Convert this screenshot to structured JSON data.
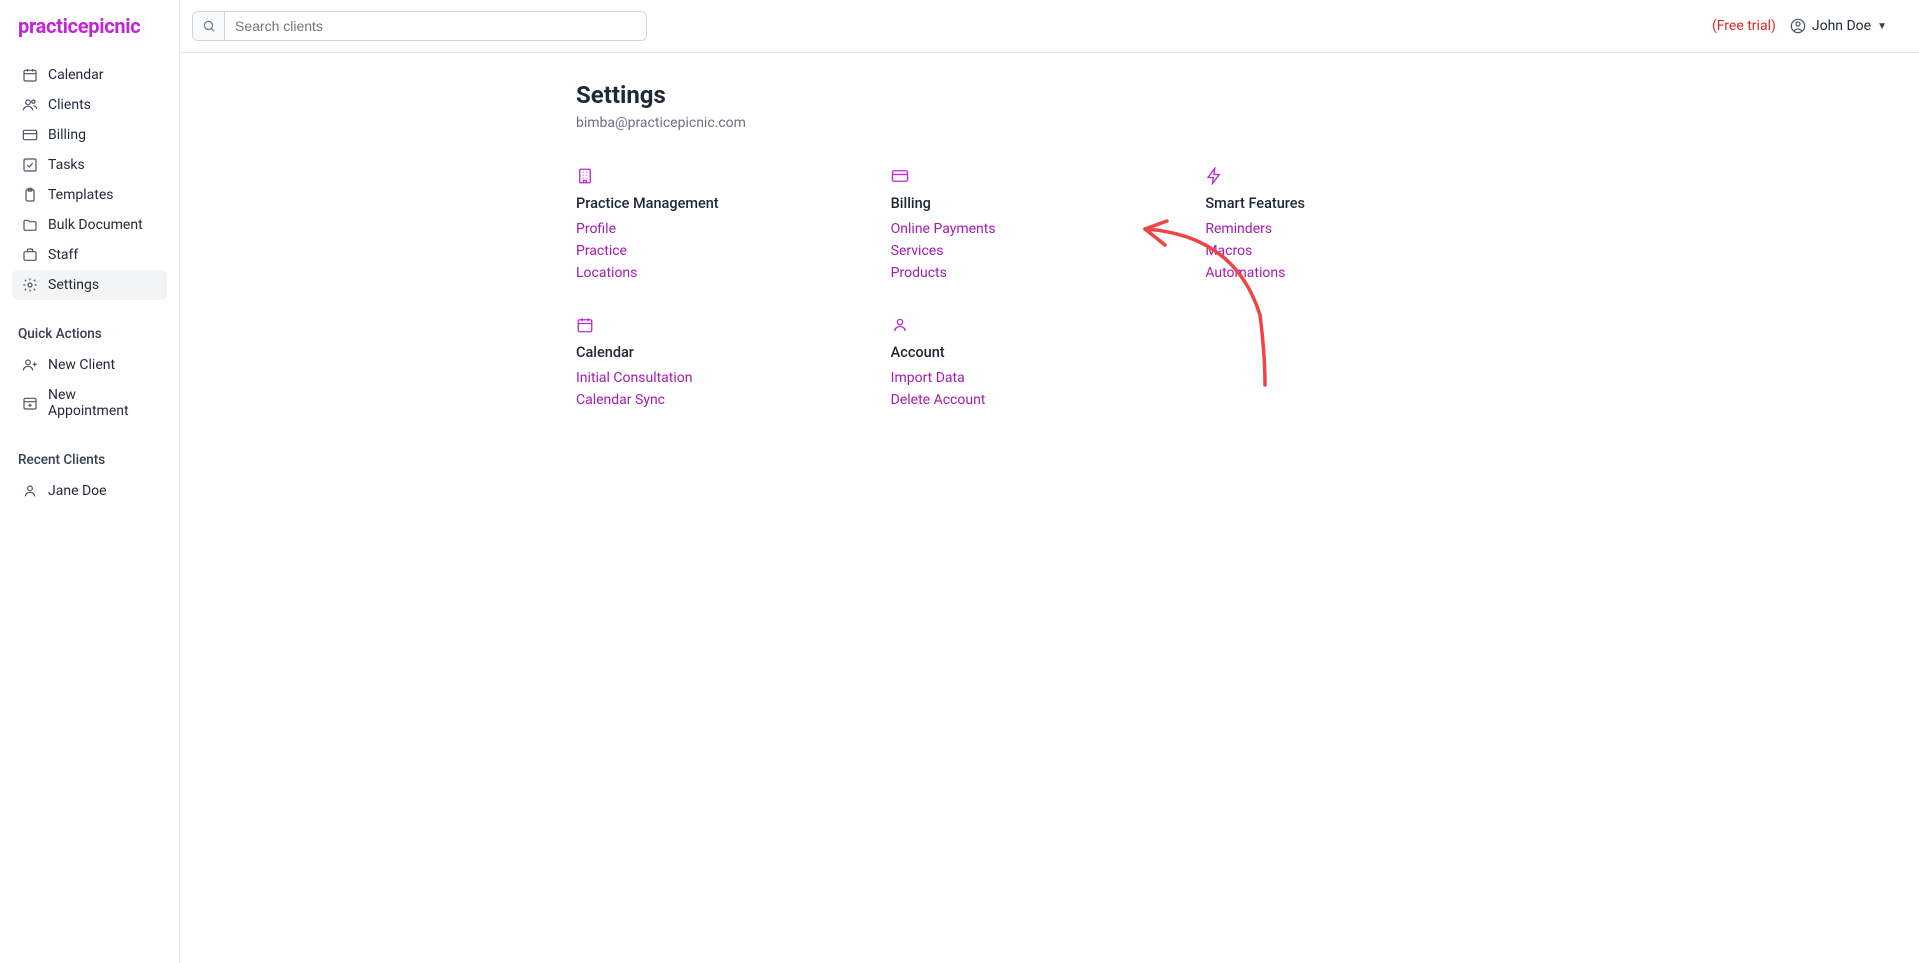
{
  "brand": "practicepicnic",
  "search": {
    "placeholder": "Search clients"
  },
  "topbar": {
    "trial": "(Free trial)",
    "user": "John Doe"
  },
  "nav": {
    "items": [
      {
        "label": "Calendar",
        "icon": "calendar"
      },
      {
        "label": "Clients",
        "icon": "users"
      },
      {
        "label": "Billing",
        "icon": "card"
      },
      {
        "label": "Tasks",
        "icon": "check-square"
      },
      {
        "label": "Templates",
        "icon": "clipboard"
      },
      {
        "label": "Bulk Document",
        "icon": "folder"
      },
      {
        "label": "Staff",
        "icon": "briefcase"
      },
      {
        "label": "Settings",
        "icon": "gear",
        "active": true
      }
    ],
    "quick_label": "Quick Actions",
    "quick": [
      {
        "label": "New Client",
        "icon": "user-plus"
      },
      {
        "label": "New Appointment",
        "icon": "calendar-plus"
      }
    ],
    "recent_label": "Recent Clients",
    "recent": [
      {
        "label": "Jane Doe",
        "icon": "user"
      }
    ]
  },
  "page": {
    "title": "Settings",
    "email": "bimba@practicepicnic.com",
    "cards": [
      {
        "title": "Practice Management",
        "icon": "building",
        "links": [
          "Profile",
          "Practice",
          "Locations"
        ]
      },
      {
        "title": "Billing",
        "icon": "card",
        "links": [
          "Online Payments",
          "Services",
          "Products"
        ]
      },
      {
        "title": "Smart Features",
        "icon": "bolt",
        "links": [
          "Reminders",
          "Macros",
          "Automations"
        ]
      },
      {
        "title": "Calendar",
        "icon": "calendar",
        "links": [
          "Initial Consultation",
          "Calendar Sync"
        ]
      },
      {
        "title": "Account",
        "icon": "user",
        "links": [
          "Import Data",
          "Delete Account"
        ]
      }
    ]
  },
  "annotation": {
    "target": "Services",
    "color": "#ef4444"
  }
}
